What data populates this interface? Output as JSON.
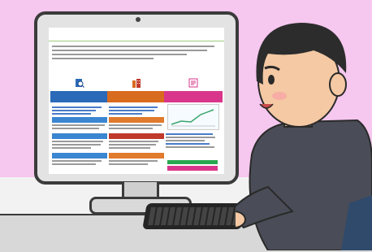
{
  "scene": {
    "background": "#f6c7ef",
    "shirt": "#4a4d57",
    "hair": "#2c2c2c",
    "skin": "#f4c9a3"
  },
  "site": {
    "logo": "",
    "logo_sub": "",
    "tag": "",
    "notice_title": "",
    "columns": [
      {
        "label": "",
        "color": "#2a6ab8",
        "icon": "search-icon"
      },
      {
        "label": "",
        "color": "#d96b1f",
        "icon": "building-icon"
      },
      {
        "label": "",
        "color": "#d9368b",
        "icon": "document-icon"
      }
    ]
  }
}
